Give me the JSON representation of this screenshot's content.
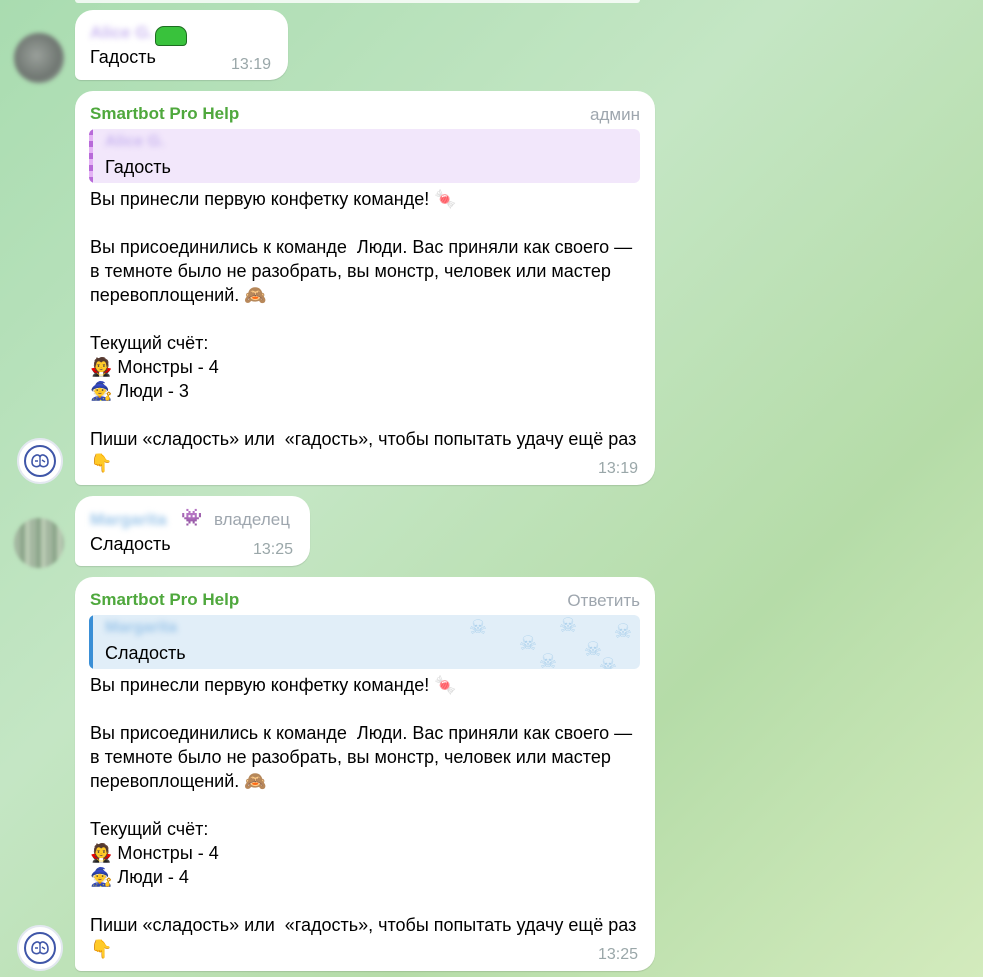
{
  "messages": [
    {
      "sender": "Alice G.",
      "text": "Гадость",
      "time": "13:19",
      "sticker_icon": "green-cat-emoji"
    },
    {
      "sender": "Smartbot Pro Help",
      "role": "админ",
      "quote": {
        "author": "Alice G.",
        "text": "Гадость"
      },
      "text": "Вы принесли первую конфетку команде! 🍬\n\nВы присоединились к команде  Люди. Вас приняли как своего — в темноте было не разобрать, вы монстр, человек или мастер перевоплощений. 🙈\n\nТекущий счёт:\n🧛 Монстры - 4\n🧙 Люди - 3\n\nПиши «сладость» или  «гадость», чтобы попытать удачу ещё раз 👇",
      "time": "13:19"
    },
    {
      "sender": "Margarita",
      "role": "владелец",
      "text": "Сладость",
      "time": "13:25"
    },
    {
      "sender": "Smartbot Pro Help",
      "action": "Ответить",
      "quote": {
        "author": "Margarita",
        "text": "Сладость"
      },
      "text": "Вы принесли первую конфетку команде! 🍬\n\nВы присоединились к команде  Люди. Вас приняли как своего — в темноте было не разобрать, вы монстр, человек или мастер перевоплощений. 🙈\n\nТекущий счёт:\n🧛 Монстры - 4\n🧙 Люди - 4\n\nПиши «сладость» или  «гадость», чтобы попытать удачу ещё раз 👇",
      "time": "13:25"
    }
  ],
  "icons": {
    "bot_avatar": "brain-icon",
    "reply_ghost": "ghost-icon",
    "owner_badge": "blue-creature-emoji"
  },
  "colors": {
    "bot_name": "#4fa83d",
    "quote_purple": "#b86ad9",
    "quote_blue": "#3a8fd6"
  }
}
